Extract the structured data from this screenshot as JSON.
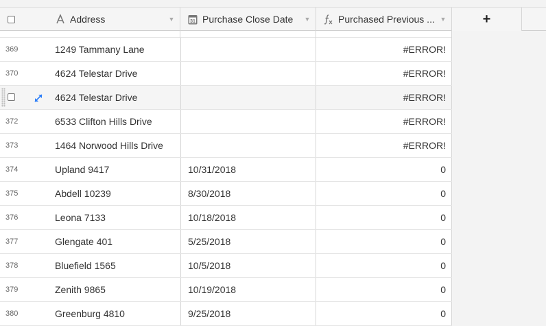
{
  "columns": {
    "address": {
      "label": "Address",
      "icon": "text-type-icon"
    },
    "purchase_close_date": {
      "label": "Purchase Close Date",
      "icon": "calendar-31-icon",
      "icon_text": "31"
    },
    "purchased_previous": {
      "label": "Purchased Previous ...",
      "icon": "formula-fx-icon"
    },
    "add_field": {
      "label": "+"
    }
  },
  "rows": [
    {
      "num": "369",
      "address": "1249 Tammany Lane",
      "date": "",
      "value": "#ERROR!"
    },
    {
      "num": "370",
      "address": "4624 Telestar Drive",
      "date": "",
      "value": "#ERROR!"
    },
    {
      "num": "",
      "address": "4624 Telestar Drive",
      "date": "",
      "value": "#ERROR!",
      "hovered": true
    },
    {
      "num": "372",
      "address": "6533 Clifton Hills Drive",
      "date": "",
      "value": "#ERROR!"
    },
    {
      "num": "373",
      "address": "1464 Norwood Hills Drive",
      "date": "",
      "value": "#ERROR!"
    },
    {
      "num": "374",
      "address": "Upland 9417",
      "date": "10/31/2018",
      "value": "0"
    },
    {
      "num": "375",
      "address": "Abdell 10239",
      "date": "8/30/2018",
      "value": "0"
    },
    {
      "num": "376",
      "address": "Leona 7133",
      "date": "10/18/2018",
      "value": "0"
    },
    {
      "num": "377",
      "address": "Glengate 401",
      "date": "5/25/2018",
      "value": "0"
    },
    {
      "num": "378",
      "address": "Bluefield 1565",
      "date": "10/5/2018",
      "value": "0"
    },
    {
      "num": "379",
      "address": "Zenith 9865",
      "date": "10/19/2018",
      "value": "0"
    },
    {
      "num": "380",
      "address": "Greenburg 4810",
      "date": "9/25/2018",
      "value": "0"
    }
  ],
  "colors": {
    "accent": "#2d7ff9",
    "header_bg": "#f5f5f5",
    "row_hover": "#f5f5f5"
  }
}
